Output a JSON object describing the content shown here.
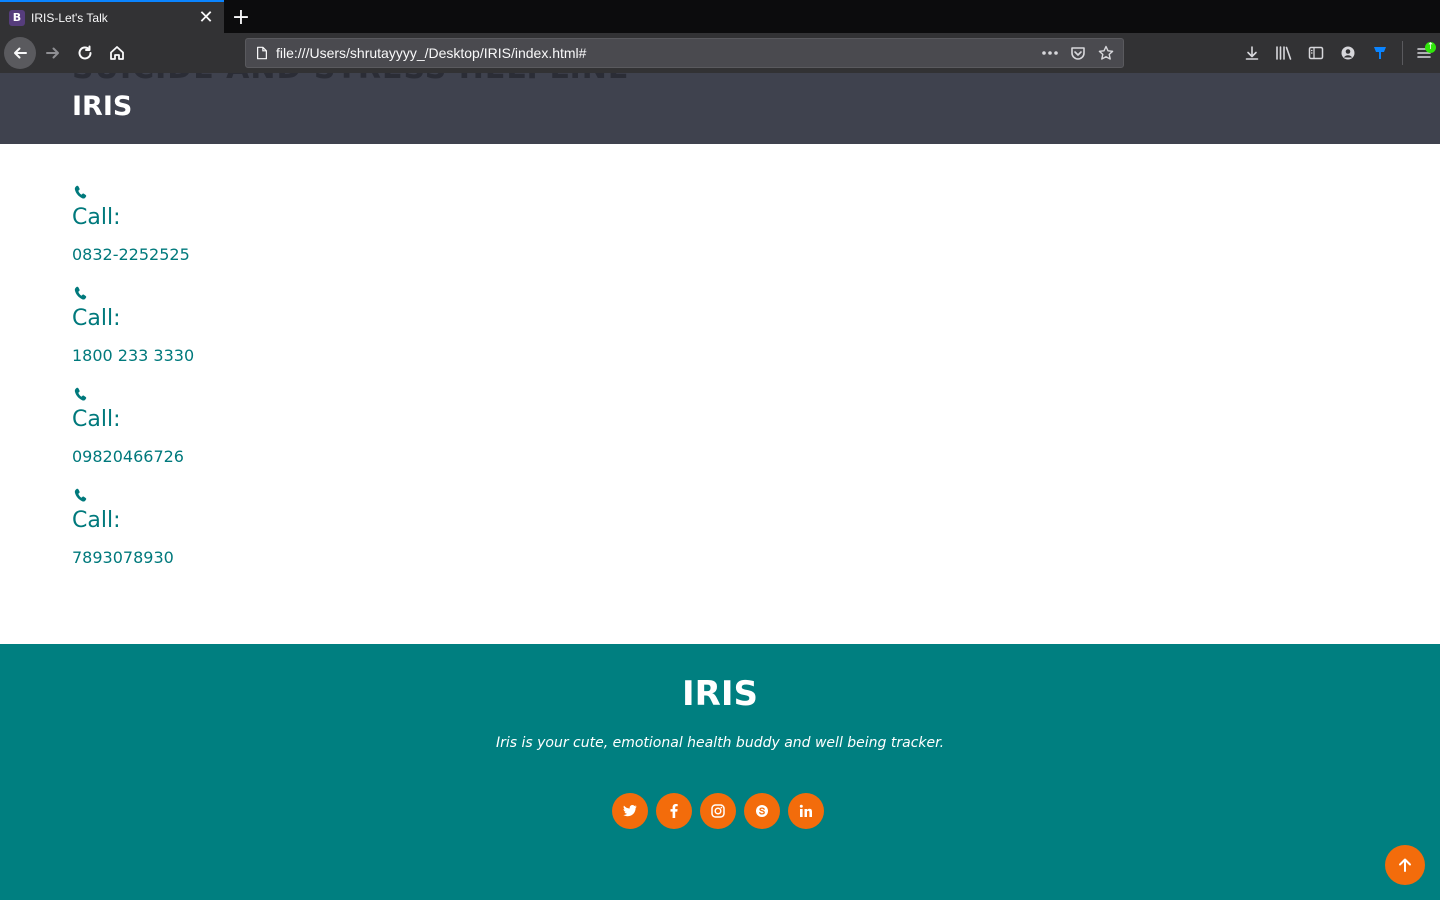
{
  "browser": {
    "tab_title": "IRIS-Let's Talk",
    "tab_favicon_letter": "B",
    "url": "file:///Users/shrutayyyy_/Desktop/IRIS/index.html#",
    "icons": {
      "back": "back-arrow-icon",
      "forward": "forward-arrow-icon",
      "reload": "reload-icon",
      "home": "home-icon",
      "page_actions": "more-dots-icon",
      "pocket": "pocket-icon",
      "bookmark": "star-icon",
      "downloads": "download-icon",
      "library": "library-icon",
      "sidebar": "sidebar-icon",
      "account": "account-icon",
      "extension": "extension-icon",
      "menu": "hamburger-menu-icon"
    }
  },
  "header": {
    "scrolled_heading": "SUICIDE AND STRESS HELPLINE",
    "brand": "IRIS"
  },
  "helplines": [
    {
      "label": "Call:",
      "number": "0832-2252525"
    },
    {
      "label": "Call:",
      "number": "1800 233 3330"
    },
    {
      "label": "Call:",
      "number": "09820466726"
    },
    {
      "label": "Call:",
      "number": "7893078930"
    }
  ],
  "footer": {
    "brand": "IRIS",
    "tagline": "Iris is your cute, emotional health buddy and well being tracker.",
    "social": [
      "twitter-icon",
      "facebook-icon",
      "instagram-icon",
      "skype-icon",
      "linkedin-icon"
    ]
  },
  "colors": {
    "accent_teal": "#007f80",
    "accent_orange": "#f36c0b",
    "header_bg": "#3f424e"
  }
}
